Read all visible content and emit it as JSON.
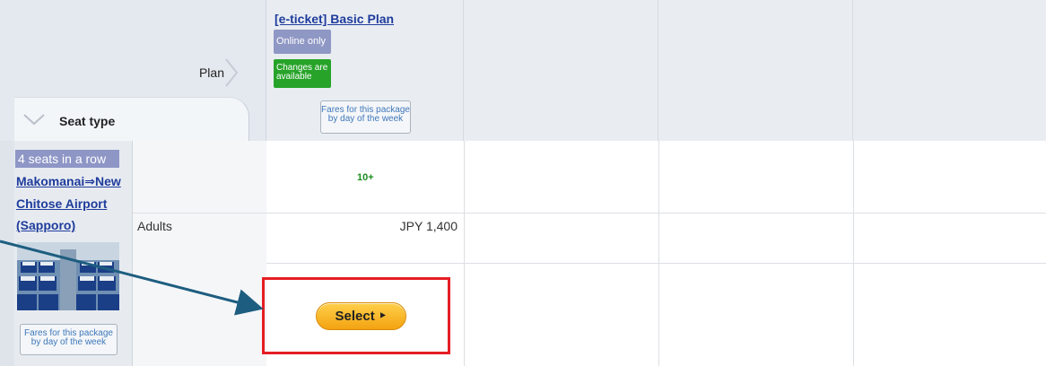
{
  "header": {
    "plan_label": "Plan",
    "seat_type_label": "Seat type"
  },
  "plan": {
    "title": "[e-ticket] Basic Plan",
    "badge_online": "Online only",
    "badge_changes_line1": "Changes are",
    "badge_changes_line2": "available",
    "fares_btn_line1": "Fares for this package",
    "fares_btn_line2": "by day of the week"
  },
  "seat": {
    "chip": "4 seats in a row",
    "route": "Makomanai⇒New Chitose Airport (Sapporo)",
    "photo_alt": "bus interior photo",
    "fares_btn_line1": "Fares for this package",
    "fares_btn_line2": "by day of the week"
  },
  "row": {
    "passenger_type": "Adults",
    "availability": "10+",
    "price": "JPY 1,400",
    "select_label": "Select ‣"
  },
  "colors": {
    "link": "#1f3c9c",
    "badge_online": "#8f97c4",
    "badge_changes": "#27a329",
    "highlight_box": "#e51e24",
    "annotation_arrow": "#1d5d80"
  }
}
